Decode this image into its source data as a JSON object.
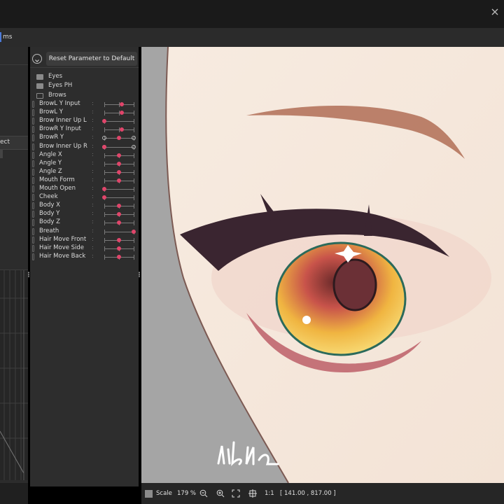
{
  "window": {
    "tab_label": "ms",
    "close_icon": "close-icon"
  },
  "left_panel": {
    "label_fragment": "ect"
  },
  "parameters_panel": {
    "reset_button": "Reset Parameter to Default",
    "folders": [
      {
        "label": "Eyes",
        "icon": "folder-icon"
      },
      {
        "label": "Eyes PH",
        "icon": "folder-icon"
      },
      {
        "label": "Brows",
        "icon": "folder-open-icon"
      }
    ],
    "params": [
      {
        "label": "BrowL Y Input",
        "value": 0.6,
        "mode": "center"
      },
      {
        "label": "BrowL Y",
        "value": 0.6,
        "mode": "center"
      },
      {
        "label": "Brow Inner Up L",
        "value": 0.0,
        "mode": "plain"
      },
      {
        "label": "BrowR Y Input",
        "value": 0.6,
        "mode": "center"
      },
      {
        "label": "BrowR Y",
        "value": 0.5,
        "mode": "keyed"
      },
      {
        "label": "Brow Inner Up R",
        "value": 0.0,
        "mode": "keyed"
      },
      {
        "label": "Angle X",
        "value": 0.5,
        "mode": "center"
      },
      {
        "label": "Angle Y",
        "value": 0.5,
        "mode": "center"
      },
      {
        "label": "Angle Z",
        "value": 0.5,
        "mode": "center"
      },
      {
        "label": "Mouth Form",
        "value": 0.5,
        "mode": "center"
      },
      {
        "label": "Mouth Open",
        "value": 0.0,
        "mode": "plain"
      },
      {
        "label": "Cheek",
        "value": 0.0,
        "mode": "plain"
      },
      {
        "label": "Body X",
        "value": 0.5,
        "mode": "center"
      },
      {
        "label": "Body Y",
        "value": 0.5,
        "mode": "center"
      },
      {
        "label": "Body Z",
        "value": 0.5,
        "mode": "center"
      },
      {
        "label": "Breath",
        "value": 1.0,
        "mode": "plain"
      },
      {
        "label": "Hair Move Front",
        "value": 0.5,
        "mode": "center"
      },
      {
        "label": "Hair Move Side",
        "value": 0.5,
        "mode": "center"
      },
      {
        "label": "Hair Move Back",
        "value": 0.5,
        "mode": "center"
      }
    ]
  },
  "canvas": {
    "signature": "nibna",
    "background_color": "#a5a5a5",
    "skin_color": "#f6e8dc"
  },
  "status_bar": {
    "scale_label": "Scale",
    "zoom": "179 %",
    "ratio": "1:1",
    "coordinates": "[  141.00 ,  817.00 ]"
  },
  "colors": {
    "accent": "#e0456a",
    "panel": "#2d2d2d"
  }
}
